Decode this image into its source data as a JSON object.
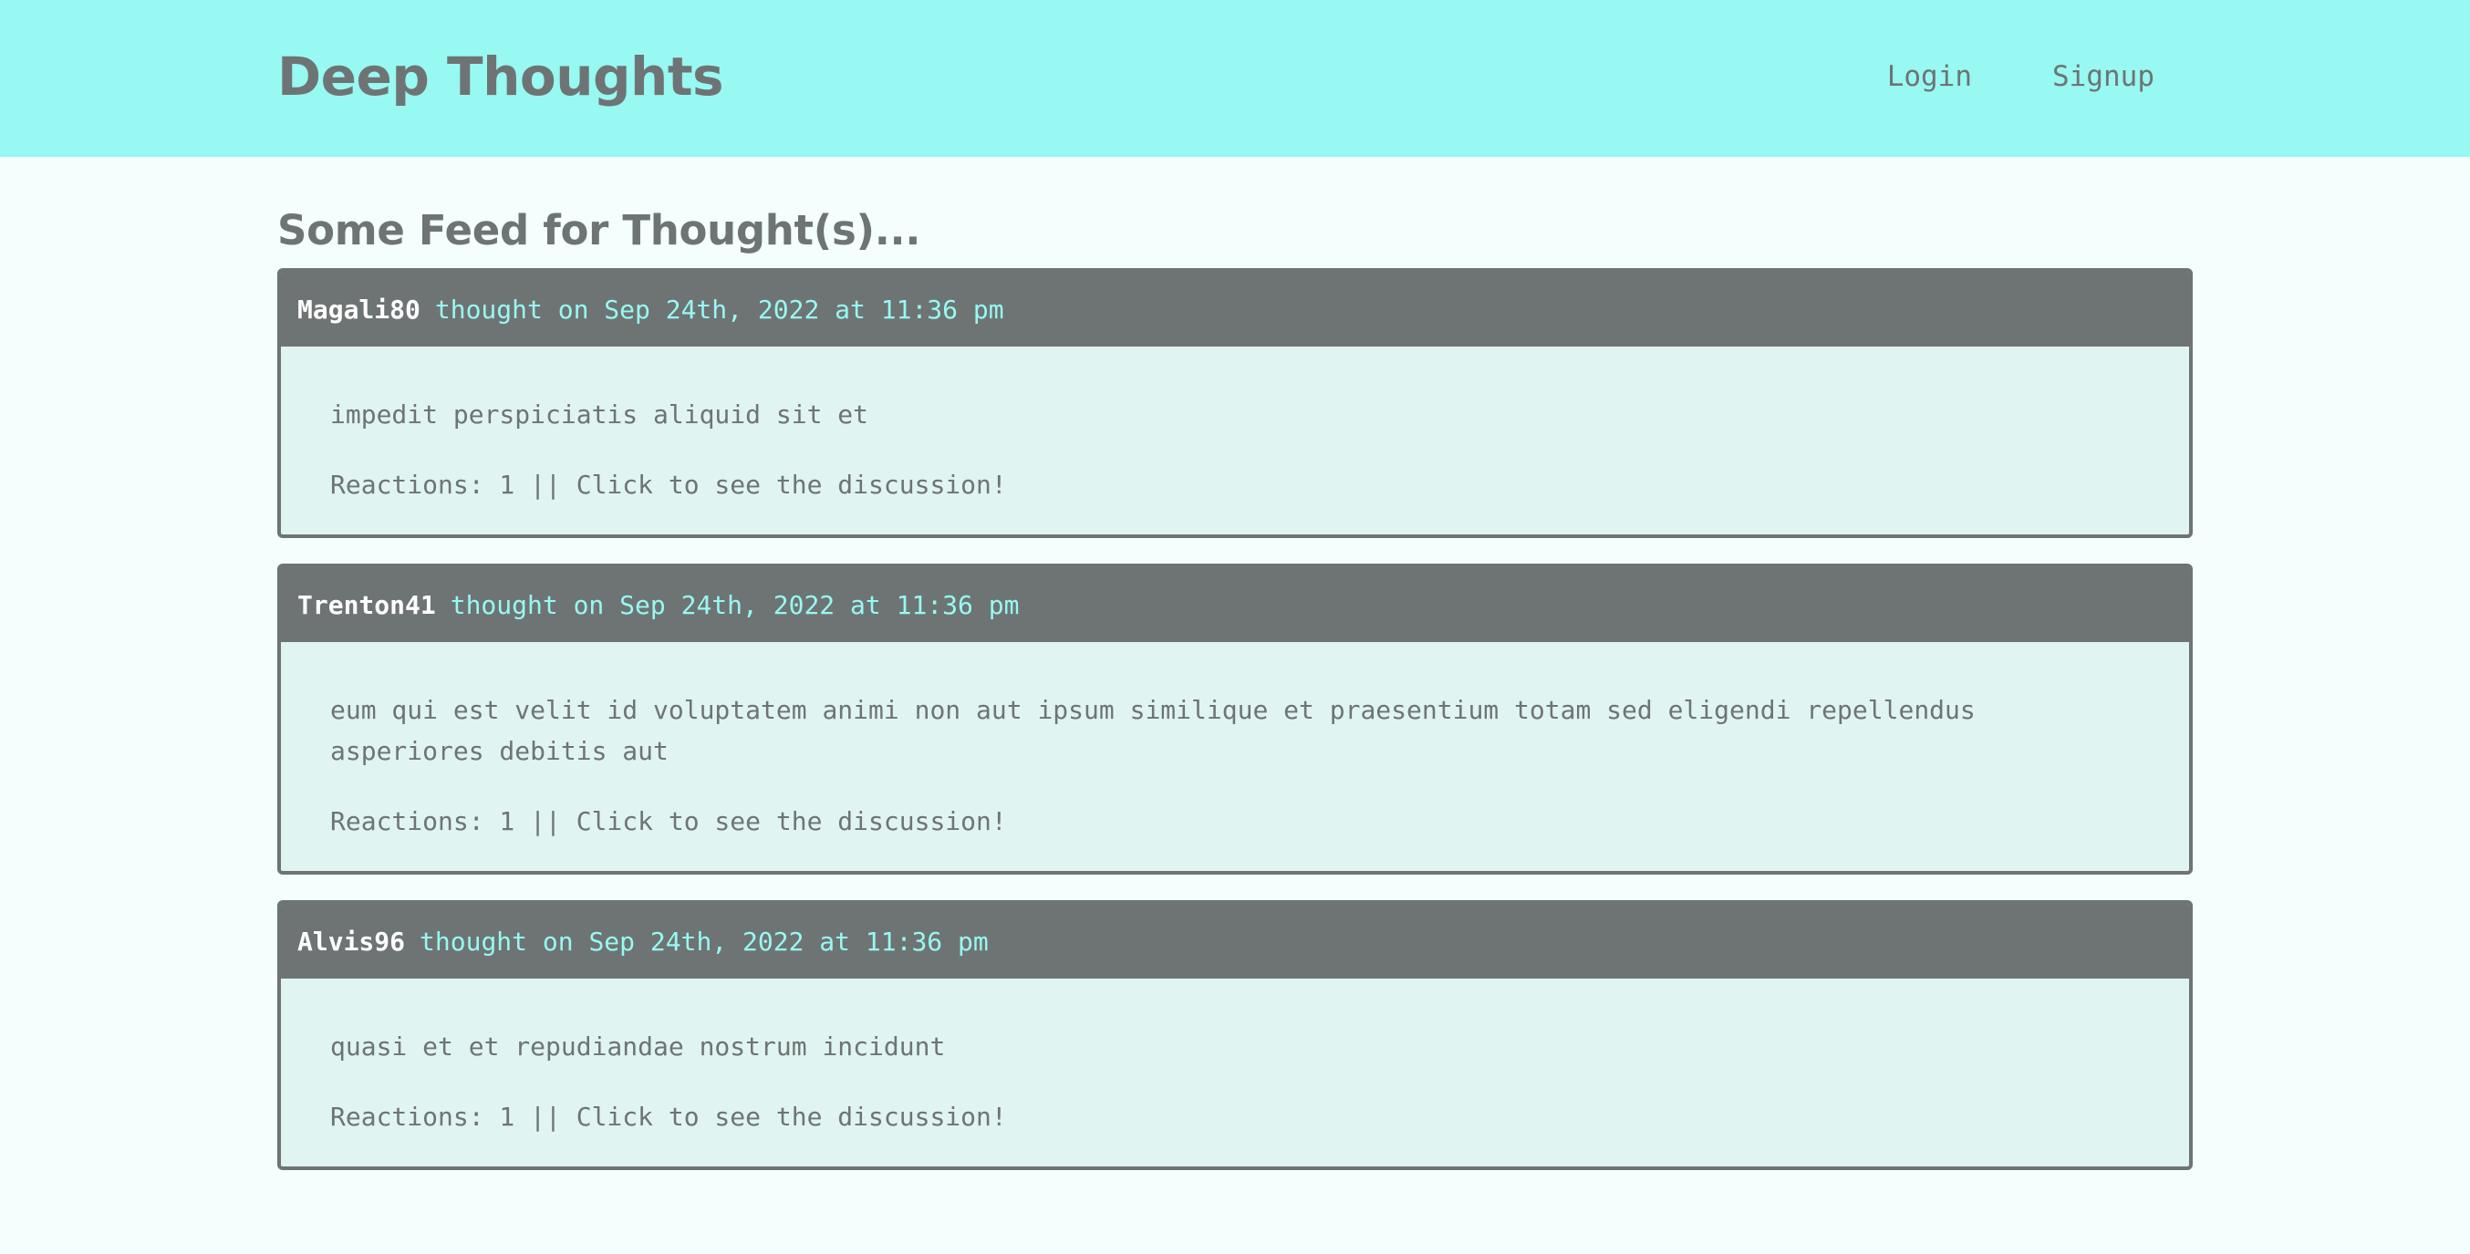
{
  "header": {
    "brand": "Deep Thoughts",
    "nav": {
      "login": "Login",
      "signup": "Signup"
    }
  },
  "main": {
    "feed_title": "Some Feed for Thought(s)...",
    "thoughts": [
      {
        "username": "Magali80",
        "meta": "thought on Sep 24th, 2022 at 11:36 pm",
        "text": "impedit perspiciatis aliquid sit et",
        "reactions": "Reactions: 1 || Click to see the discussion!"
      },
      {
        "username": "Trenton41",
        "meta": "thought on Sep 24th, 2022 at 11:36 pm",
        "text": "eum qui est velit id voluptatem animi non aut ipsum similique et praesentium totam sed eligendi repellendus asperiores debitis aut",
        "reactions": "Reactions: 1 || Click to see the discussion!"
      },
      {
        "username": "Alvis96",
        "meta": "thought on Sep 24th, 2022 at 11:36 pm",
        "text": "quasi et et repudiandae nostrum incidunt",
        "reactions": "Reactions: 1 || Click to see the discussion!"
      }
    ]
  },
  "colors": {
    "header_bg": "#98f8f2",
    "page_bg": "#f3fefd",
    "card_bg": "#e0f4f2",
    "card_header_bg": "#6e7474",
    "text": "#6e7474",
    "accent": "#98f8f2"
  }
}
